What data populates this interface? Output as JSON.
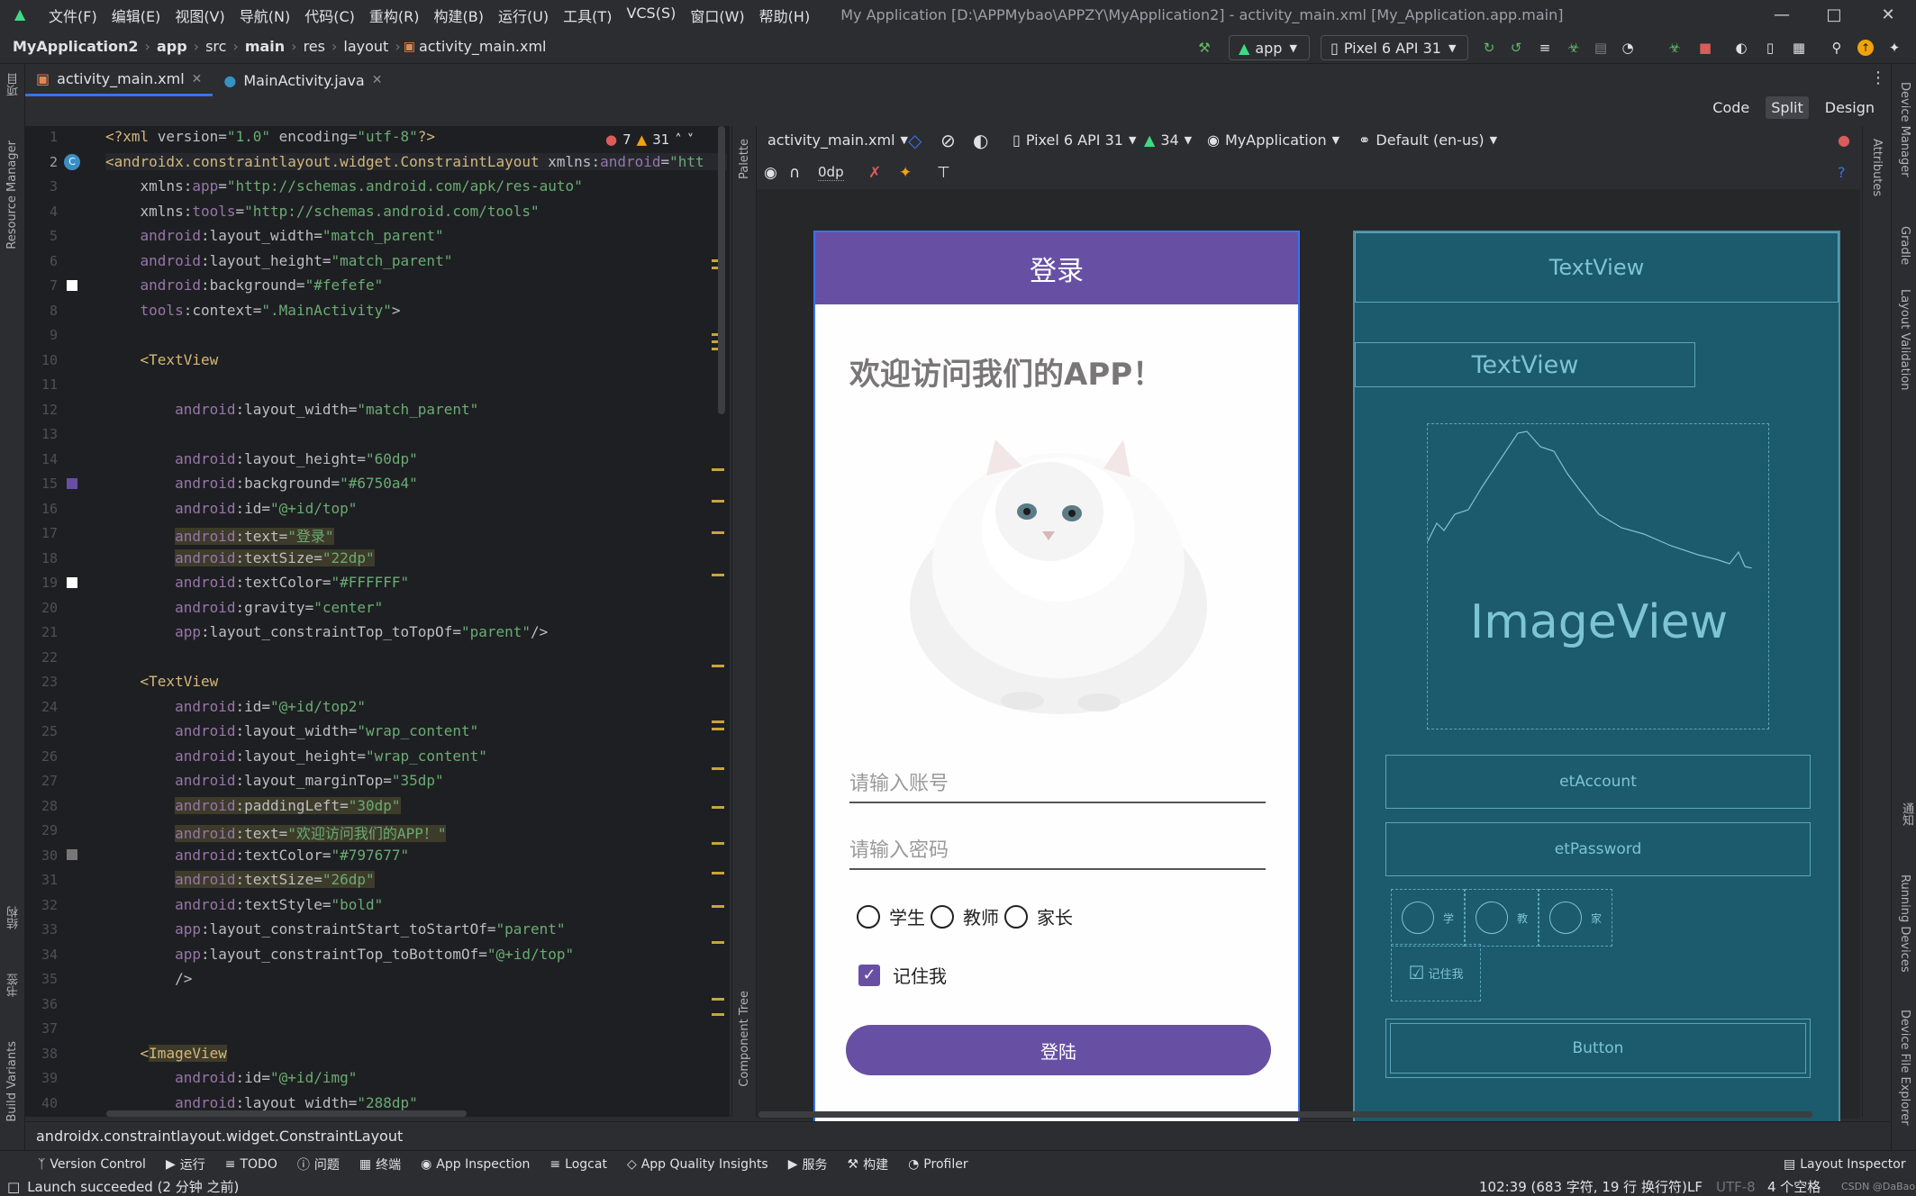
{
  "menu": [
    "文件(F)",
    "编辑(E)",
    "视图(V)",
    "导航(N)",
    "代码(C)",
    "重构(R)",
    "构建(B)",
    "运行(U)",
    "工具(T)",
    "VCS(S)",
    "窗口(W)",
    "帮助(H)"
  ],
  "window_title": "My Application [D:\\APPMybao\\APPZY\\MyApplication2] - activity_main.xml [My_Application.app.main]",
  "breadcrumb": [
    "MyApplication2",
    "app",
    "src",
    "main",
    "res",
    "layout",
    "activity_main.xml"
  ],
  "run_config": "app",
  "device": "Pixel 6 API 31",
  "tabs": [
    {
      "label": "activity_main.xml",
      "active": true
    },
    {
      "label": "MainActivity.java",
      "active": false
    }
  ],
  "left_tools": [
    "项目",
    "Resource Manager",
    "结构",
    "书签",
    "Build Variants"
  ],
  "right_tools": [
    "Device Manager",
    "Gradle",
    "Layout Validation",
    "通知",
    "Running Devices",
    "Device File Explorer"
  ],
  "inspection": {
    "errors": "7",
    "warnings": "31"
  },
  "view_modes": {
    "code": "Code",
    "split": "Split",
    "design": "Design"
  },
  "code_lines": [
    {
      "n": "1"
    },
    {
      "n": "2"
    },
    {
      "n": "3"
    },
    {
      "n": "4"
    },
    {
      "n": "5"
    },
    {
      "n": "6"
    },
    {
      "n": "7"
    },
    {
      "n": "8"
    },
    {
      "n": "9"
    },
    {
      "n": "10"
    },
    {
      "n": "11"
    },
    {
      "n": "12"
    },
    {
      "n": "13"
    },
    {
      "n": "14"
    },
    {
      "n": "15"
    },
    {
      "n": "16"
    },
    {
      "n": "17"
    },
    {
      "n": "18"
    },
    {
      "n": "19"
    },
    {
      "n": "20"
    },
    {
      "n": "21"
    },
    {
      "n": "22"
    },
    {
      "n": "23"
    },
    {
      "n": "24"
    },
    {
      "n": "25"
    },
    {
      "n": "26"
    },
    {
      "n": "27"
    },
    {
      "n": "28"
    },
    {
      "n": "29"
    },
    {
      "n": "30"
    },
    {
      "n": "31"
    },
    {
      "n": "32"
    },
    {
      "n": "33"
    },
    {
      "n": "34"
    },
    {
      "n": "35"
    },
    {
      "n": "36"
    },
    {
      "n": "37"
    },
    {
      "n": "38"
    },
    {
      "n": "39"
    },
    {
      "n": "40"
    }
  ],
  "design_toolbar": {
    "file": "activity_main.xml",
    "device": "Pixel 6 API 31",
    "api": "34",
    "theme": "MyApplication",
    "locale": "Default (en-us)",
    "margin": "0dp"
  },
  "side_labels": {
    "palette": "Palette",
    "component_tree": "Component Tree",
    "attributes": "Attributes"
  },
  "preview": {
    "header": "登录",
    "welcome": "欢迎访问我们的APP！",
    "account_hint": "请输入账号",
    "password_hint": "请输入密码",
    "radios": [
      "学生",
      "教师",
      "家长"
    ],
    "remember": "记住我",
    "login_button": "登陆"
  },
  "blueprint": {
    "top": "TextView",
    "welcome": "TextView",
    "image": "ImageView",
    "account": "etAccount",
    "password": "etPassword",
    "radio_labels": [
      "学",
      "教",
      "家"
    ],
    "remember": "记住我",
    "button": "Button"
  },
  "editor_breadcrumb": "androidx.constraintlayout.widget.ConstraintLayout",
  "tool_windows": [
    "Version Control",
    "运行",
    "TODO",
    "问题",
    "终端",
    "App Inspection",
    "Logcat",
    "App Quality Insights",
    "服务",
    "构建",
    "Profiler"
  ],
  "layout_inspector": "Layout Inspector",
  "status": {
    "message": "Launch succeeded (2 分钟 之前)",
    "position": "102:39 (683 字符, 19 行 换行符)",
    "line_sep": "LF",
    "encoding": "UTF-8",
    "indent": "4 个空格",
    "watermark": "CSDN @DaBao"
  },
  "colors": {
    "accent": "#3574f0",
    "purple": "#6750a4",
    "blueprint": "#1c5a6e"
  }
}
